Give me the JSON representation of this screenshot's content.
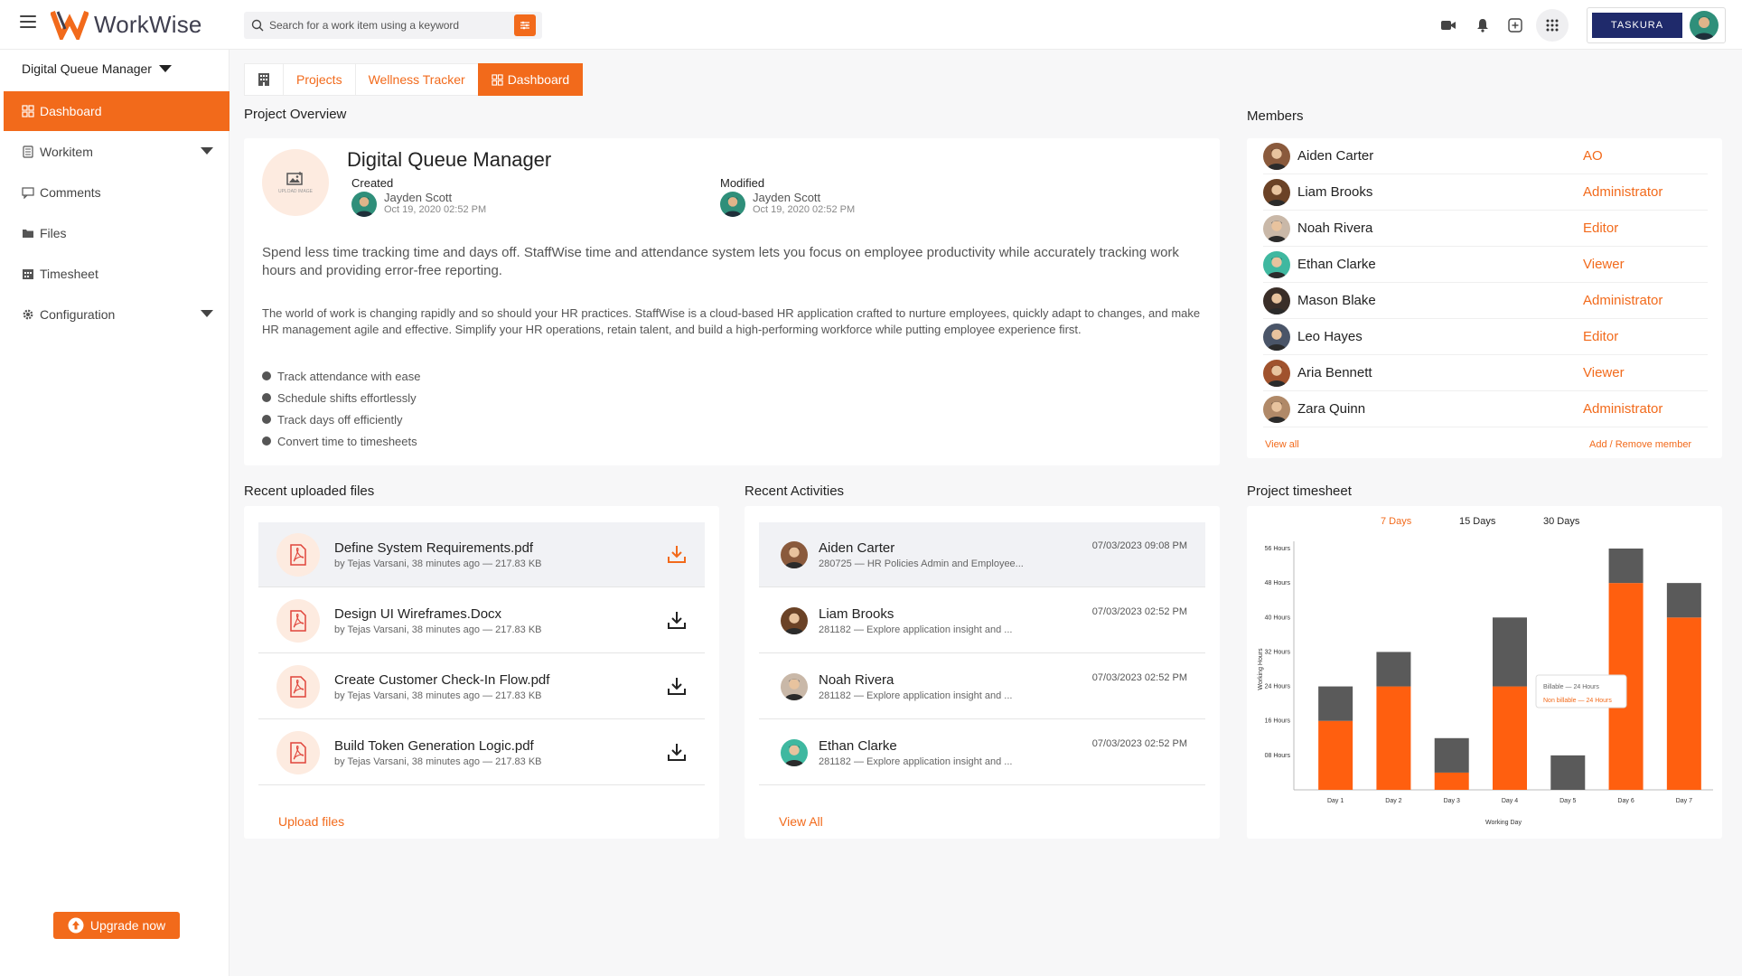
{
  "header": {
    "app_name": "WorkWise",
    "search_placeholder": "Search for a work item using a keyword",
    "org_logo_text": "TASKURA"
  },
  "sidebar": {
    "project_selector": "Digital Queue Manager",
    "items": [
      {
        "label": "Dashboard",
        "icon": "dashboard-icon"
      },
      {
        "label": "Workitem",
        "icon": "workitem-icon"
      },
      {
        "label": "Comments",
        "icon": "comments-icon"
      },
      {
        "label": "Files",
        "icon": "folder-icon"
      },
      {
        "label": "Timesheet",
        "icon": "timesheet-icon"
      },
      {
        "label": "Configuration",
        "icon": "gear-icon"
      }
    ],
    "upgrade_label": "Upgrade now"
  },
  "breadcrumb": {
    "items": [
      "Projects",
      "Wellness Tracker",
      "Dashboard"
    ]
  },
  "overview": {
    "section_title": "Project Overview",
    "upload_label": "UPLOAD IMAGE",
    "project_name": "Digital Queue Manager",
    "created_label": "Created",
    "created_by": "Jayden Scott",
    "created_at": "Oct 19, 2020 02:52 PM",
    "modified_label": "Modified",
    "modified_by": "Jayden Scott",
    "modified_at": "Oct 19, 2020 02:52 PM",
    "description_main": "Spend less time tracking time and days off. StaffWise time and attendance system lets you focus on employee productivity while accurately tracking work hours and providing error-free reporting.",
    "description_detail": "The world of work is changing rapidly and so should your HR practices. StaffWise is a cloud-based HR application crafted to nurture employees, quickly adapt to changes, and make HR management agile and effective. Simplify your HR operations, retain talent, and build a high-performing workforce while putting employee experience first.",
    "bullets": [
      "Track attendance with ease",
      "Schedule shifts effortlessly",
      "Track days off efficiently",
      "Convert time to timesheets"
    ]
  },
  "members": {
    "section_title": "Members",
    "list": [
      {
        "name": "Aiden Carter",
        "role": "AO",
        "avatar_color": "#8a5a3c"
      },
      {
        "name": "Liam Brooks",
        "role": "Administrator",
        "avatar_color": "#6b4226"
      },
      {
        "name": "Noah Rivera",
        "role": "Editor",
        "avatar_color": "#c9b8a8"
      },
      {
        "name": "Ethan Clarke",
        "role": "Viewer",
        "avatar_color": "#3fb8a0"
      },
      {
        "name": "Mason Blake",
        "role": "Administrator",
        "avatar_color": "#3a2e28"
      },
      {
        "name": "Leo Hayes",
        "role": "Editor",
        "avatar_color": "#4a5568"
      },
      {
        "name": "Aria Bennett",
        "role": "Viewer",
        "avatar_color": "#a0522d"
      },
      {
        "name": "Zara Quinn",
        "role": "Administrator",
        "avatar_color": "#b08968"
      }
    ],
    "view_all": "View all",
    "add_remove": "Add / Remove member"
  },
  "files": {
    "section_title": "Recent uploaded files",
    "list": [
      {
        "title": "Define System Requirements.pdf",
        "meta": "by Tejas Varsani, 38 minutes ago — 217.83 KB"
      },
      {
        "title": "Design UI Wireframes.Docx",
        "meta": "by Tejas Varsani, 38 minutes ago — 217.83 KB"
      },
      {
        "title": "Create Customer Check-In Flow.pdf",
        "meta": "by Tejas Varsani, 38 minutes ago — 217.83 KB"
      },
      {
        "title": "Build Token Generation Logic.pdf",
        "meta": "by Tejas Varsani, 38 minutes ago — 217.83 KB"
      }
    ],
    "upload_label": "Upload files"
  },
  "activities": {
    "section_title": "Recent Activities",
    "list": [
      {
        "name": "Aiden Carter",
        "detail": "280725 — HR Policies Admin and Employee...",
        "date": "07/03/2023 09:08 PM",
        "avatar_color": "#8a5a3c"
      },
      {
        "name": "Liam Brooks",
        "detail": "281182 — Explore application insight and ...",
        "date": "07/03/2023 02:52 PM",
        "avatar_color": "#6b4226"
      },
      {
        "name": "Noah Rivera",
        "detail": "281182 — Explore application insight and ...",
        "date": "07/03/2023 02:52 PM",
        "avatar_color": "#c9b8a8"
      },
      {
        "name": "Ethan Clarke",
        "detail": "281182 — Explore application insight and ...",
        "date": "07/03/2023 02:52 PM",
        "avatar_color": "#3fb8a0"
      }
    ],
    "view_all": "View All"
  },
  "timesheet": {
    "section_title": "Project timesheet",
    "tabs": [
      "7 Days",
      "15 Days",
      "30 Days"
    ],
    "active_tab": "7 Days",
    "tooltip_billable": "Billable — 24 Hours",
    "tooltip_nonbillable": "Non billable — 24 Hours"
  },
  "chart_data": {
    "type": "bar",
    "stacked": true,
    "categories": [
      "Day 1",
      "Day 2",
      "Day 3",
      "Day 4",
      "Day 5",
      "Day 6",
      "Day 7"
    ],
    "series": [
      {
        "name": "Non billable",
        "values": [
          16,
          24,
          4,
          24,
          0,
          48,
          40
        ],
        "color": "#ff5f0f"
      },
      {
        "name": "Billable",
        "values": [
          8,
          8,
          8,
          16,
          8,
          8,
          8
        ],
        "color": "#5a5a5a"
      }
    ],
    "y_ticks": [
      "08 Hours",
      "16 Hours",
      "24 Hours",
      "32 Hours",
      "40 Hours",
      "48 Hours",
      "56 Hours"
    ],
    "ylim": [
      0,
      56
    ],
    "xlabel": "Working Day",
    "ylabel": "Working Hours"
  }
}
